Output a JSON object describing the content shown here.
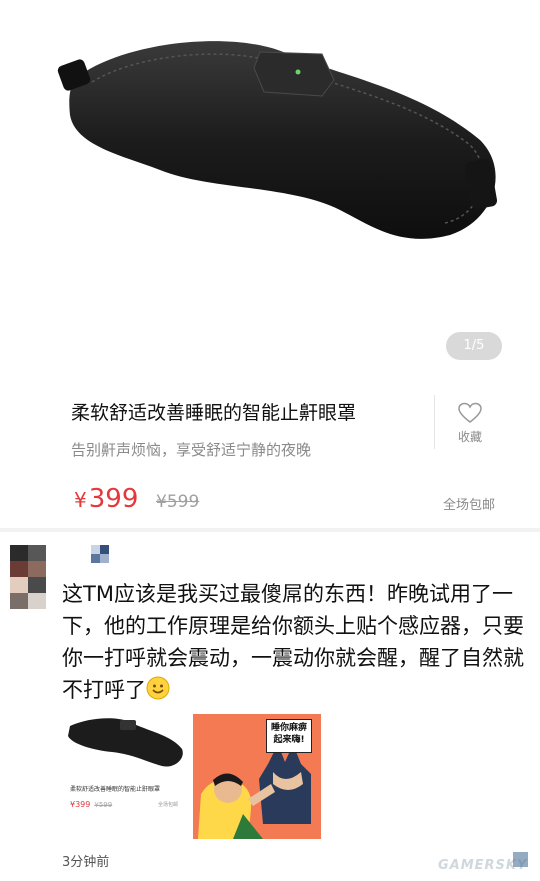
{
  "product": {
    "image_counter": "1/5",
    "title": "柔软舒适改善睡眠的智能止鼾眼罩",
    "subtitle": "告别鼾声烦恼，享受舒适宁静的夜晚",
    "favorite_label": "收藏",
    "currency": "¥",
    "price": "399",
    "original_price": "¥599",
    "shipping": "全场包邮"
  },
  "post": {
    "text": "这TM应该是我买过最傻屌的东西！昨晚试用了一下，他的工作原理是给你额头上贴个感应器，只要你一打呼就会震动，一震动你就会醒，醒了自然就不打呼了",
    "emoji": "smile-emoji",
    "thumbnail_1": {
      "title": "柔软舒适改善睡眠的智能止鼾眼罩",
      "price": "¥399",
      "original_price": "¥599",
      "shipping": "全场包邮"
    },
    "thumbnail_2": {
      "bubble_text": "睡你麻痹起来嗨!"
    },
    "time": "3分钟前"
  },
  "watermark": "GAMERSKY",
  "colors": {
    "price_red": "#e4393c",
    "muted_gray": "#8a8a8a",
    "meme_orange": "#f47a53"
  }
}
